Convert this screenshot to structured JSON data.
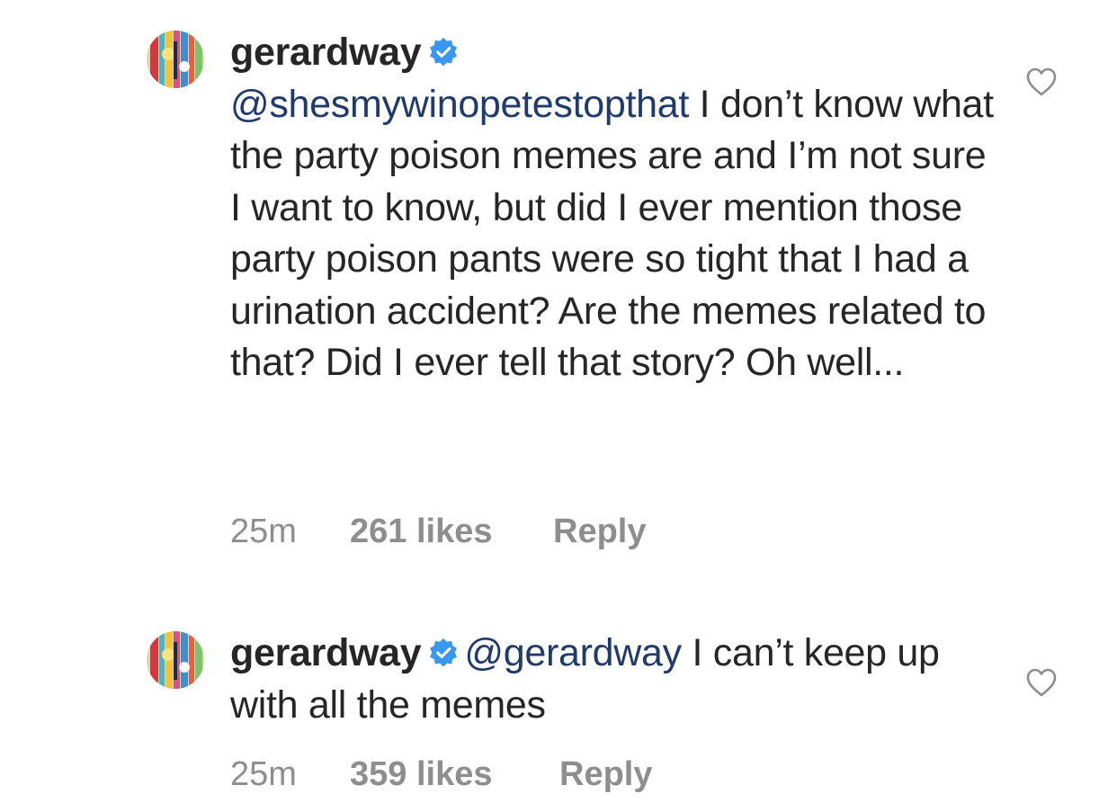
{
  "comments": [
    {
      "username": "gerardway",
      "verified": true,
      "mention": "@shesmywinopetestopthat",
      "text": " I don’t know what the party poison memes are and I’m not sure I want to know, but did I ever mention those party poison pants were so tight that I had a urination accident? Are the memes related to that? Did I ever tell that story? Oh well...",
      "time": "25m",
      "likes": "261 likes",
      "reply_label": "Reply"
    },
    {
      "username": "gerardway",
      "verified": true,
      "mention": "@gerardway",
      "text": " I can’t keep up with all the memes",
      "time": "25m",
      "likes": "359 likes",
      "reply_label": "Reply"
    }
  ],
  "colors": {
    "text": "#262626",
    "mention": "#1f3a6b",
    "meta": "#8e8e8e",
    "verified": "#3897f0"
  },
  "icons": {
    "like": "heart-outline-icon",
    "verified": "verified-badge-icon"
  }
}
